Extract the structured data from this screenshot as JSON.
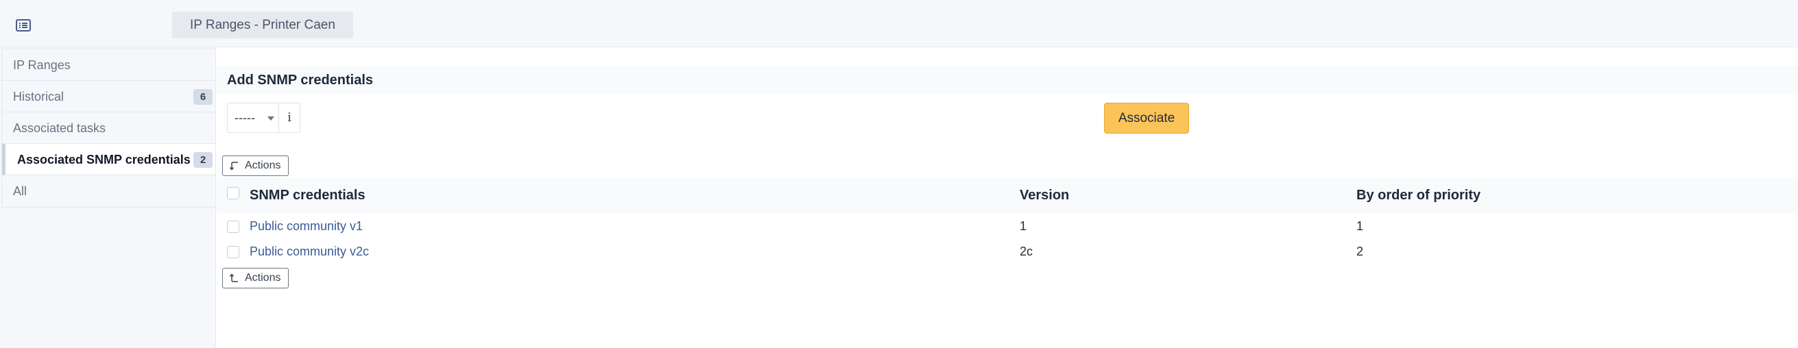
{
  "header": {
    "title": "IP Ranges - Printer Caen",
    "menu_icon": "list-icon"
  },
  "sidebar": {
    "items": [
      {
        "label": "IP Ranges",
        "badge": null,
        "active": false
      },
      {
        "label": "Historical",
        "badge": "6",
        "active": false
      },
      {
        "label": "Associated tasks",
        "badge": null,
        "active": false
      },
      {
        "label": "Associated SNMP credentials",
        "badge": "2",
        "active": true
      },
      {
        "label": "All",
        "badge": null,
        "active": false
      }
    ]
  },
  "main": {
    "section_title": "Add SNMP credentials",
    "select": {
      "value": "-----",
      "info_label": "i"
    },
    "associate_label": "Associate",
    "actions_label": "Actions",
    "table": {
      "columns": [
        "SNMP credentials",
        "Version",
        "By order of priority"
      ],
      "rows": [
        {
          "name": "Public community v1",
          "version": "1",
          "priority": "1"
        },
        {
          "name": "Public community v2c",
          "version": "2c",
          "priority": "2"
        }
      ]
    }
  },
  "colors": {
    "accent": "#fcc458",
    "link": "#3b5a9a",
    "badge": "#d4dcea"
  }
}
